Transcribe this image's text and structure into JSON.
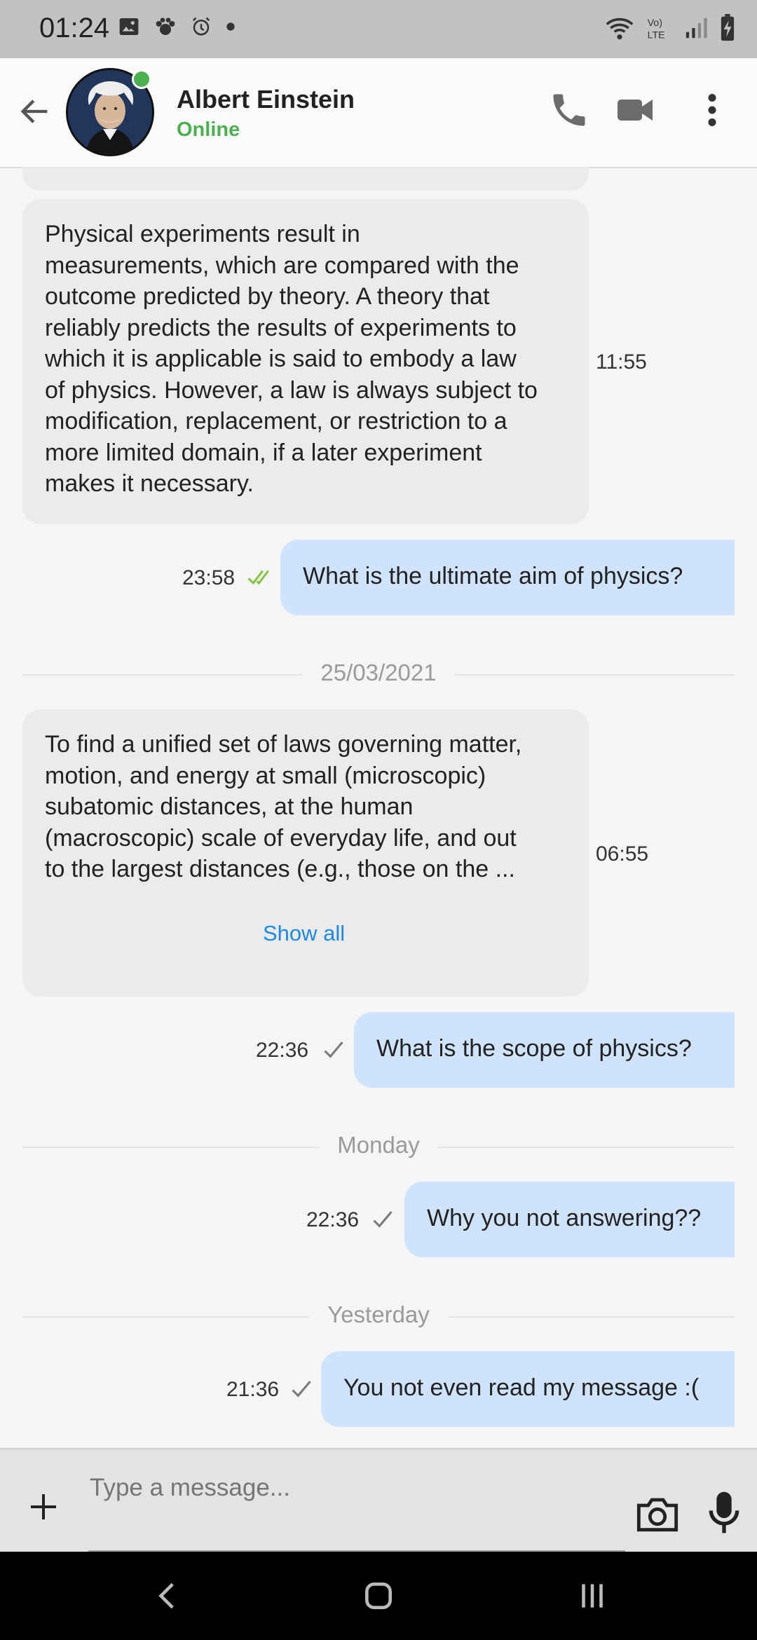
{
  "status_bar": {
    "time": "01:24"
  },
  "contact": {
    "name": "Albert Einstein",
    "presence": "Online"
  },
  "messages": [
    {
      "direction": "incoming",
      "text": "Physical experiments result in\nmeasurements, which are compared with the\noutcome predicted by theory. A theory that\nreliably predicts the results of experiments to\nwhich it is applicable is said to embody a law\nof physics. However, a law is always subject to\nmodification, replacement, or restriction to a\nmore limited domain, if a later experiment\nmakes it necessary.",
      "time": "11:55"
    },
    {
      "direction": "outgoing",
      "text": "What is the ultimate aim of physics?",
      "time": "23:58",
      "receipt": "read"
    },
    {
      "direction": "incoming",
      "text": "To find a unified set of laws governing matter,\nmotion, and energy at small (microscopic)\nsubatomic distances, at the human\n(macroscopic) scale of everyday life, and out\nto the largest distances (e.g., those on the ...",
      "time": "06:55",
      "action": "Show all"
    },
    {
      "direction": "outgoing",
      "text": "What is the scope of physics?",
      "time": "22:36",
      "receipt": "sent"
    },
    {
      "direction": "outgoing",
      "text": "Why you not answering??",
      "time": "22:36",
      "receipt": "sent"
    },
    {
      "direction": "outgoing",
      "text": "You not even read my message :(",
      "time": "21:36",
      "receipt": "sent"
    }
  ],
  "date_separators": [
    "25/03/2021",
    "Monday",
    "Yesterday"
  ],
  "composer": {
    "placeholder": "Type a message..."
  },
  "colors": {
    "accent_green": "#4caf50",
    "link_blue": "#1e88e5",
    "outgoing_bubble": "#cfe3fd",
    "incoming_bubble": "#ebebeb"
  }
}
